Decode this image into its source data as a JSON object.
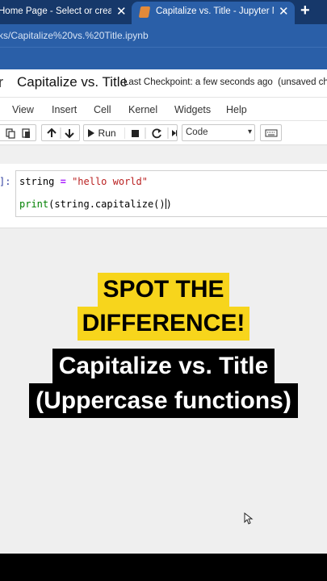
{
  "browser": {
    "tabs": [
      {
        "label": "Home Page - Select or create a n",
        "active": false
      },
      {
        "label": "Capitalize vs. Title - Jupyter Note",
        "active": true
      }
    ],
    "close_glyph": "✕",
    "new_tab_glyph": "+",
    "url": "ks/Capitalize%20vs.%20Title.ipynb"
  },
  "jupyter": {
    "logo_fragment": "r",
    "notebook_title": "Capitalize vs. Title",
    "checkpoint": "Last Checkpoint: a few seconds ago",
    "unsaved": "(unsaved chan",
    "menu": [
      "View",
      "Insert",
      "Cell",
      "Kernel",
      "Widgets",
      "Help"
    ],
    "toolbar": {
      "run_label": "Run",
      "cell_type": "Code"
    },
    "cell": {
      "prompt": "]:",
      "line1": {
        "var": "string",
        "op": "=",
        "str": "\"hello world\""
      },
      "line2": {
        "builtin": "print",
        "rest": "(string.capitalize()",
        "close": ")"
      }
    }
  },
  "overlay": {
    "yellow_lines": [
      "SPOT THE",
      "DIFFERENCE!"
    ],
    "black_lines": [
      "Capitalize vs. Title",
      "(Uppercase functions)"
    ]
  },
  "colors": {
    "tab_bar": "#16386a",
    "chrome_blue": "#2a5fa8",
    "highlight_yellow": "#f7d51c",
    "caption_black": "#000000"
  }
}
